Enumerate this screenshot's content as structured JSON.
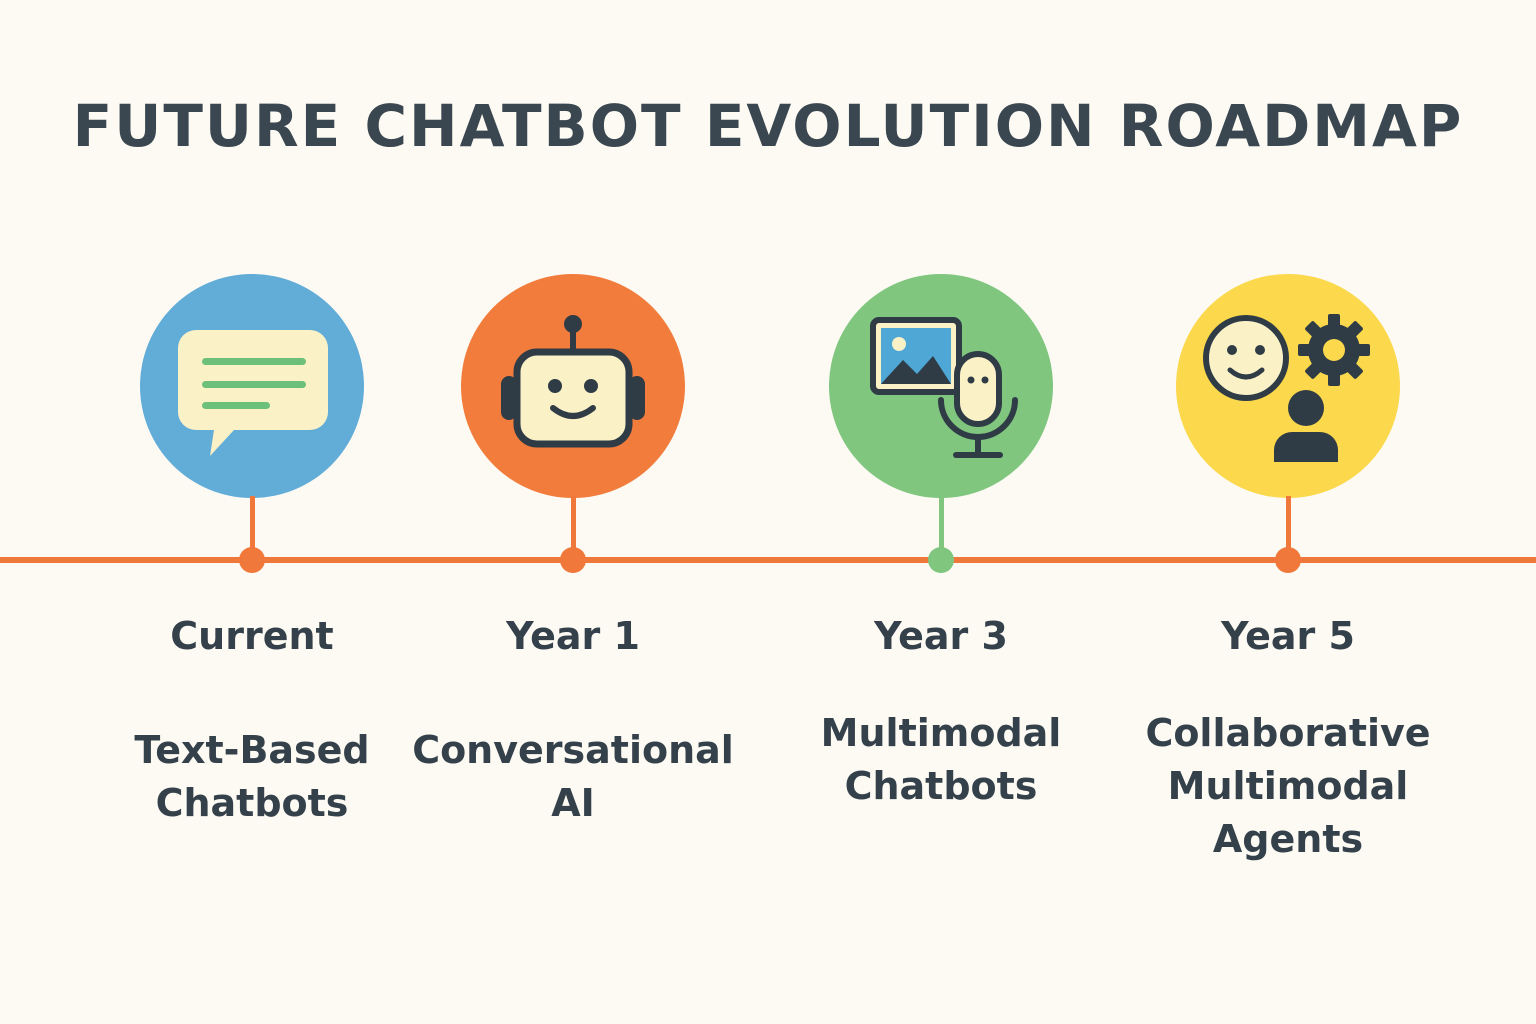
{
  "title": "FUTURE CHATBOT EVOLUTION ROADMAP",
  "colors": {
    "background": "#fcfaf3",
    "timeline": "#f0783a",
    "text": "#34404a"
  },
  "milestones": [
    {
      "period": "Current",
      "description": "Text-Based\nChatbots",
      "color": "#62acd8",
      "connector_color": "#f0783a",
      "icon": "chat-bubble-icon"
    },
    {
      "period": "Year 1",
      "description": "Conversational\nAI",
      "color": "#f27c3c",
      "connector_color": "#f0783a",
      "icon": "robot-icon"
    },
    {
      "period": "Year 3",
      "description": "Multimodal\nChatbots",
      "color": "#80c67f",
      "connector_color": "#80c67f",
      "icon": "image-microphone-icon"
    },
    {
      "period": "Year 5",
      "description": "Collaborative\nMultimodal\nAgents",
      "color": "#fbd84c",
      "connector_color": "#f0783a",
      "icon": "smiley-gear-person-icon"
    }
  ]
}
